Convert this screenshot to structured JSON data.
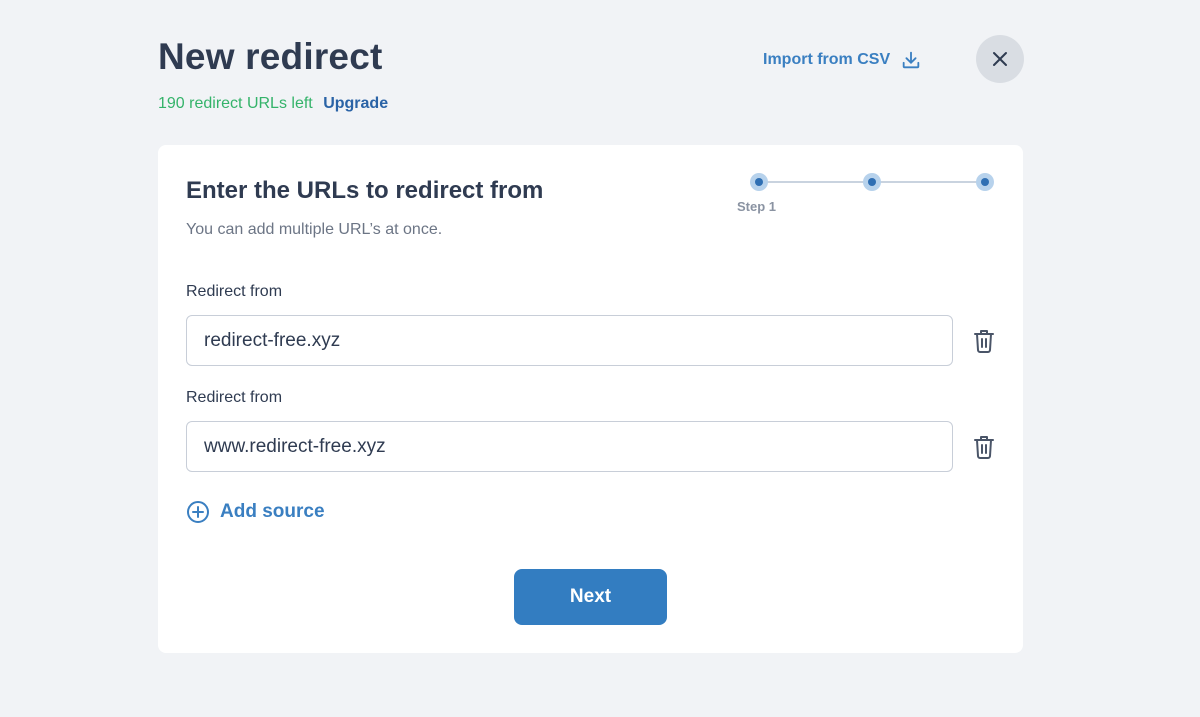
{
  "header": {
    "title": "New redirect",
    "quota_text": "190 redirect URLs left",
    "upgrade_label": "Upgrade",
    "import_label": "Import from CSV",
    "import_icon": "download-icon",
    "close_icon": "close-icon"
  },
  "card": {
    "heading": "Enter the URLs to redirect from",
    "subtext": "You can add multiple URL’s at once.",
    "stepper": {
      "total_steps": 3,
      "current_step": 1,
      "current_label": "Step 1"
    },
    "sources": [
      {
        "label": "Redirect from",
        "value": "redirect-free.xyz",
        "delete_icon": "trash-icon"
      },
      {
        "label": "Redirect from",
        "value": "www.redirect-free.xyz",
        "delete_icon": "trash-icon"
      }
    ],
    "add_source_label": "Add source",
    "add_source_icon": "plus-circle-icon",
    "next_label": "Next"
  },
  "colors": {
    "background": "#f1f3f6",
    "accent": "#337dc1",
    "quota_green": "#34b36a",
    "title_text": "#2f3b51"
  }
}
